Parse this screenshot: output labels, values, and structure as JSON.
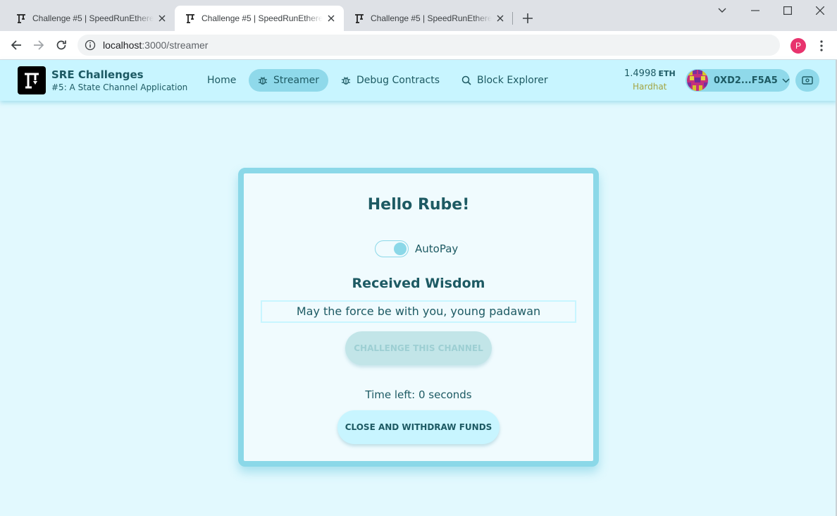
{
  "browser": {
    "tabs": [
      {
        "title": "Challenge #5 | SpeedRunEthereum"
      },
      {
        "title": "Challenge #5 | SpeedRunEthereum"
      },
      {
        "title": "Challenge #5 | SpeedRunEthereum"
      }
    ],
    "url_host": "localhost",
    "url_path": ":3000/streamer",
    "profile_initial": "P"
  },
  "header": {
    "brand_title": "SRE Challenges",
    "brand_subtitle": "#5: A State Channel Application",
    "nav": {
      "home": "Home",
      "streamer": "Streamer",
      "debug": "Debug Contracts",
      "explorer": "Block Explorer"
    },
    "balance": "1.4998",
    "balance_unit": "ETH",
    "network": "Hardhat",
    "address": "0XD2...F5A5"
  },
  "card": {
    "greeting": "Hello Rube!",
    "autopay_label": "AutoPay",
    "autopay_on": true,
    "wisdom_title": "Received Wisdom",
    "wisdom_text": "May the force be with you, young padawan",
    "challenge_button": "CHALLENGE THIS CHANNEL",
    "time_left": "Time left: 0 seconds",
    "close_button": "CLOSE AND WITHDRAW FUNDS"
  },
  "colors": {
    "page_bg": "#e2f9fe",
    "header_bg": "#c8f5ff",
    "accent": "#8bd8e8",
    "text": "#1d5a63",
    "network": "#a3a442"
  }
}
